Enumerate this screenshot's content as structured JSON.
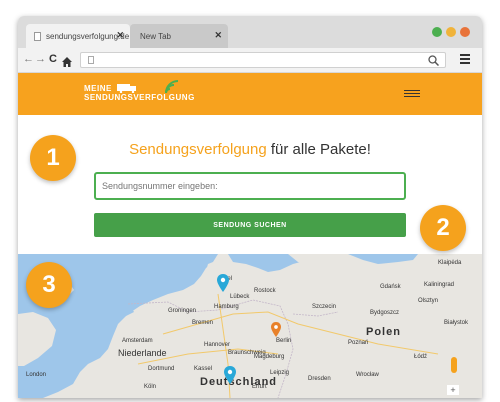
{
  "browser": {
    "tabs": [
      {
        "label": "sendungsverfolgung.de",
        "close": "✕",
        "active": true
      },
      {
        "label": "New Tab",
        "close": "✕",
        "active": false
      }
    ],
    "window_controls": [
      "#4caf50",
      "#f0b33a",
      "#e8733a"
    ],
    "icons": {
      "back": "arrow-left-icon",
      "forward": "arrow-right-icon",
      "reload": "reload-icon",
      "home": "home-icon",
      "search": "search-icon",
      "menu": "menu-icon"
    }
  },
  "site": {
    "logo_line1": "MEINE",
    "logo_line2": "SENDUNGSVERFOLGUNG",
    "headline_accent": "Sendungsverfolgung",
    "headline_rest": " für alle Pakete!",
    "search_placeholder": "Sendungsnummer eingeben:",
    "search_button": "SENDUNG SUCHEN",
    "colors": {
      "header": "#f7a21e",
      "accent": "#f5a21d",
      "button": "#46a049",
      "input_border": "#4caf50"
    }
  },
  "steps": [
    "1",
    "2",
    "3"
  ],
  "map": {
    "labels": {
      "country_de": "Deutschland",
      "country_nl": "Niederlande",
      "country_pl": "Polen",
      "hamburg": "Hamburg",
      "berlin": "Berlin",
      "bremen": "Bremen",
      "hannover": "Hannover",
      "luebeck": "Lübeck",
      "rostock": "Rostock",
      "kiel": "Kiel",
      "szczecin": "Szczecin",
      "leipzig": "Leipzig",
      "dresden": "Dresden",
      "poznan": "Poznań",
      "amsterdam": "Amsterdam",
      "braunschweig": "Braunschweig",
      "magdeburg": "Magdeburg",
      "wroclaw": "Wrocław",
      "dortmund": "Dortmund",
      "koeln": "Köln",
      "erfurt": "Erfurt",
      "kassel": "Kassel",
      "london": "London",
      "bialystok": "Białystok",
      "lodz": "Łódź",
      "gdansk": "Gdańsk",
      "kaliningrad": "Kaliningrad",
      "bydgoszcz": "Bydgoszcz",
      "groningen": "Groningen",
      "klaipeda": "Klaipėda",
      "olsztyn": "Olsztyn"
    },
    "markers": [
      "#29a8d8",
      "#e8812a",
      "#29a8d8"
    ]
  }
}
